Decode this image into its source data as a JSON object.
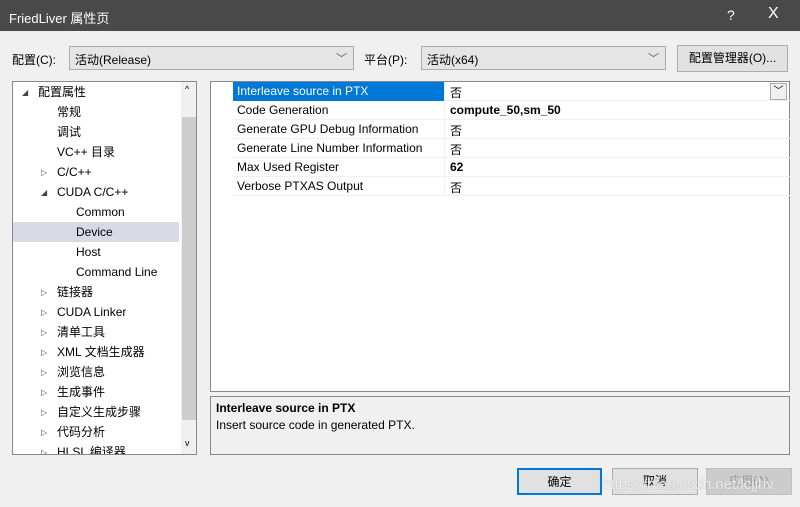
{
  "window": {
    "title": "FriedLiver 属性页",
    "help": "?",
    "close": "X"
  },
  "toolbar": {
    "config_label": "配置(C):",
    "config_value": "活动(Release)",
    "platform_label": "平台(P):",
    "platform_value": "活动(x64)",
    "config_manager": "配置管理器(O)..."
  },
  "tree": [
    {
      "label": "配置属性",
      "level": 0,
      "tw": "down"
    },
    {
      "label": "常规",
      "level": 1
    },
    {
      "label": "调试",
      "level": 1
    },
    {
      "label": "VC++ 目录",
      "level": 1
    },
    {
      "label": "C/C++",
      "level": 1,
      "tw": "right"
    },
    {
      "label": "CUDA C/C++",
      "level": 1,
      "tw": "down"
    },
    {
      "label": "Common",
      "level": 2
    },
    {
      "label": "Device",
      "level": 2,
      "selected": true
    },
    {
      "label": "Host",
      "level": 2
    },
    {
      "label": "Command Line",
      "level": 2
    },
    {
      "label": "链接器",
      "level": 1,
      "tw": "right"
    },
    {
      "label": "CUDA Linker",
      "level": 1,
      "tw": "right"
    },
    {
      "label": "清单工具",
      "level": 1,
      "tw": "right"
    },
    {
      "label": "XML 文档生成器",
      "level": 1,
      "tw": "right"
    },
    {
      "label": "浏览信息",
      "level": 1,
      "tw": "right"
    },
    {
      "label": "生成事件",
      "level": 1,
      "tw": "right"
    },
    {
      "label": "自定义生成步骤",
      "level": 1,
      "tw": "right"
    },
    {
      "label": "代码分析",
      "level": 1,
      "tw": "right"
    },
    {
      "label": "HLSL 编译器",
      "level": 1,
      "tw": "right"
    }
  ],
  "properties": [
    {
      "name": "Interleave source in PTX",
      "value": "否",
      "bold": false,
      "selected": true
    },
    {
      "name": "Code Generation",
      "value": "compute_50,sm_50",
      "bold": true
    },
    {
      "name": "Generate GPU Debug Information",
      "value": "否",
      "bold": false
    },
    {
      "name": "Generate Line Number Information",
      "value": "否",
      "bold": false
    },
    {
      "name": "Max Used Register",
      "value": "62",
      "bold": true
    },
    {
      "name": "Verbose PTXAS Output",
      "value": "否",
      "bold": false
    }
  ],
  "description": {
    "title": "Interleave source in PTX",
    "text": "Insert source code in generated PTX."
  },
  "buttons": {
    "ok": "确定",
    "cancel": "取消",
    "apply": "应用(A)"
  },
  "watermark": "https://blog.csdn.net/lcjjhv"
}
